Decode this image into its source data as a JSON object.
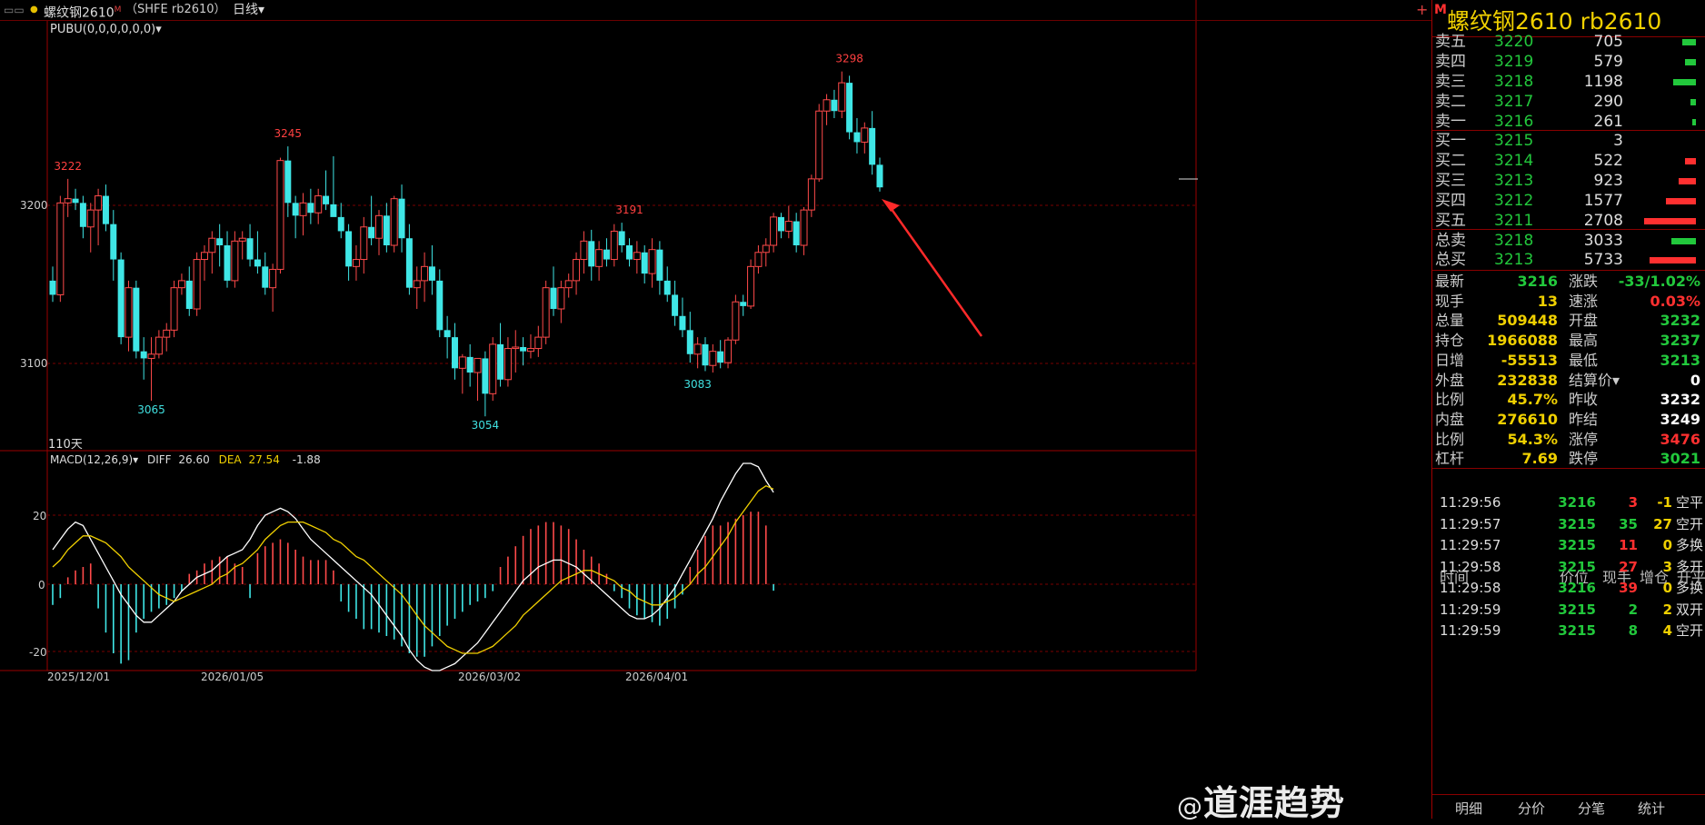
{
  "top_bar": {
    "window_icons": "▭▭",
    "dot": "●",
    "title": "螺纹钢2610",
    "badge": "M",
    "code": "（SHFE rb2610）",
    "period": "日线",
    "period_caret": "▾",
    "add": "+"
  },
  "main_chart": {
    "indicator": "PUBU(0,0,0,0,0,0)",
    "indicator_caret": "▾",
    "days_label": "110天",
    "y_ticks": [
      "3200",
      "3100"
    ],
    "annotations": [
      {
        "text": "3222",
        "color": "#ff4040"
      },
      {
        "text": "3245",
        "color": "#ff4040"
      },
      {
        "text": "3065",
        "color": "#40e0e0"
      },
      {
        "text": "3054",
        "color": "#40e0e0"
      },
      {
        "text": "3191",
        "color": "#ff4040"
      },
      {
        "text": "3083",
        "color": "#40e0e0"
      },
      {
        "text": "3298",
        "color": "#ff4040"
      }
    ]
  },
  "macd": {
    "name": "MACD(12,26,9)",
    "caret": "▾",
    "diff_label": "DIFF",
    "diff_value": "26.60",
    "dea_label": "DEA",
    "dea_value": "27.54",
    "macd_value": "-1.88",
    "y_ticks": [
      "20",
      "0",
      "-20"
    ]
  },
  "x_axis": {
    "dates": [
      "2025/12/01",
      "2026/01/05",
      "2026/03/02",
      "2026/04/01"
    ]
  },
  "right_panel": {
    "marker": "M",
    "title": "螺纹钢2610  rb2610",
    "asks": [
      {
        "label": "卖五",
        "price": "3220",
        "vol": "705",
        "bar": 0.1
      },
      {
        "label": "卖四",
        "price": "3219",
        "vol": "579",
        "bar": 0.08
      },
      {
        "label": "卖三",
        "price": "3218",
        "vol": "1198",
        "bar": 0.17
      },
      {
        "label": "卖二",
        "price": "3217",
        "vol": "290",
        "bar": 0.04
      },
      {
        "label": "卖一",
        "price": "3216",
        "vol": "261",
        "bar": 0.03
      }
    ],
    "bids": [
      {
        "label": "买一",
        "price": "3215",
        "vol": "3",
        "bar": 0
      },
      {
        "label": "买二",
        "price": "3214",
        "vol": "522",
        "bar": 0.08
      },
      {
        "label": "买三",
        "price": "3213",
        "vol": "923",
        "bar": 0.13
      },
      {
        "label": "买四",
        "price": "3212",
        "vol": "1577",
        "bar": 0.22
      },
      {
        "label": "买五",
        "price": "3211",
        "vol": "2708",
        "bar": 0.38
      }
    ],
    "totals": [
      {
        "label": "总卖",
        "price": "3218",
        "vol": "3033",
        "bar": 0.18,
        "color": "#22c83c"
      },
      {
        "label": "总买",
        "price": "3213",
        "vol": "5733",
        "bar": 0.34,
        "color": "#ff3030"
      }
    ],
    "quotes": [
      {
        "l": "最新",
        "v": "3216",
        "vc": "#22c83c",
        "l2": "涨跌",
        "v2": "-33/1.02%",
        "v2c": "#22c83c"
      },
      {
        "l": "现手",
        "v": "13",
        "vc": "#f0d000",
        "l2": "速涨",
        "v2": "0.03%",
        "v2c": "#ff3030"
      },
      {
        "l": "总量",
        "v": "509448",
        "vc": "#f0d000",
        "l2": "开盘",
        "v2": "3232",
        "v2c": "#22c83c"
      },
      {
        "l": "持仓",
        "v": "1966088",
        "vc": "#f0d000",
        "l2": "最高",
        "v2": "3237",
        "v2c": "#22c83c"
      },
      {
        "l": "日增",
        "v": "-55513",
        "vc": "#f0d000",
        "l2": "最低",
        "v2": "3213",
        "v2c": "#22c83c"
      },
      {
        "l": "外盘",
        "v": "232838",
        "vc": "#f0d000",
        "l2": "结算价▾",
        "v2": "0",
        "v2c": "#ffffff"
      },
      {
        "l": "比例",
        "v": "45.7%",
        "vc": "#f0d000",
        "l2": "昨收",
        "v2": "3232",
        "v2c": "#ffffff"
      },
      {
        "l": "内盘",
        "v": "276610",
        "vc": "#f0d000",
        "l2": "昨结",
        "v2": "3249",
        "v2c": "#ffffff"
      },
      {
        "l": "比例",
        "v": "54.3%",
        "vc": "#f0d000",
        "l2": "涨停",
        "v2": "3476",
        "v2c": "#ff3030"
      },
      {
        "l": "杠杆",
        "v": "7.69",
        "vc": "#f0d000",
        "l2": "跌停",
        "v2": "3021",
        "v2c": "#22c83c"
      }
    ],
    "trade_headers": [
      "时间",
      "价位",
      "现手",
      "增仓",
      "开平"
    ],
    "trades": [
      {
        "time": "11:29:56",
        "price": "3216",
        "vol": "3",
        "vc": "#ff3030",
        "chg": "-1",
        "type": "空平"
      },
      {
        "time": "11:29:57",
        "price": "3215",
        "vol": "35",
        "vc": "#22c83c",
        "chg": "27",
        "type": "空开"
      },
      {
        "time": "11:29:57",
        "price": "3215",
        "vol": "11",
        "vc": "#ff3030",
        "chg": "0",
        "type": "多换"
      },
      {
        "time": "11:29:58",
        "price": "3215",
        "vol": "27",
        "vc": "#ff3030",
        "chg": "3",
        "type": "多开"
      },
      {
        "time": "11:29:58",
        "price": "3216",
        "vol": "39",
        "vc": "#ff3030",
        "chg": "0",
        "type": "多换"
      },
      {
        "time": "11:29:59",
        "price": "3215",
        "vol": "2",
        "vc": "#22c83c",
        "chg": "2",
        "type": "双开"
      },
      {
        "time": "11:29:59",
        "price": "3215",
        "vol": "8",
        "vc": "#22c83c",
        "chg": "4",
        "type": "空开"
      }
    ],
    "tabs": [
      "明细",
      "分价",
      "分笔",
      "统计"
    ]
  },
  "watermark": {
    "at": "@",
    "text": "道涯趋势"
  },
  "chart_data": {
    "type": "candlestick",
    "y_min": 3040,
    "y_max": 3310,
    "macd_range": [
      -27,
      35
    ],
    "candles": [
      [
        3150,
        3160,
        3135,
        3140
      ],
      [
        3140,
        3210,
        3135,
        3205
      ],
      [
        3205,
        3222,
        3195,
        3208
      ],
      [
        3208,
        3215,
        3200,
        3205
      ],
      [
        3205,
        3210,
        3180,
        3188
      ],
      [
        3188,
        3205,
        3170,
        3200
      ],
      [
        3200,
        3215,
        3175,
        3210
      ],
      [
        3210,
        3218,
        3185,
        3190
      ],
      [
        3190,
        3200,
        3150,
        3165
      ],
      [
        3165,
        3170,
        3105,
        3110
      ],
      [
        3110,
        3150,
        3100,
        3145
      ],
      [
        3145,
        3150,
        3095,
        3100
      ],
      [
        3100,
        3110,
        3080,
        3095
      ],
      [
        3095,
        3110,
        3065,
        3098
      ],
      [
        3098,
        3115,
        3095,
        3110
      ],
      [
        3110,
        3120,
        3100,
        3115
      ],
      [
        3115,
        3150,
        3110,
        3145
      ],
      [
        3145,
        3155,
        3140,
        3150
      ],
      [
        3150,
        3160,
        3125,
        3130
      ],
      [
        3130,
        3170,
        3125,
        3165
      ],
      [
        3165,
        3175,
        3150,
        3170
      ],
      [
        3170,
        3185,
        3155,
        3180
      ],
      [
        3180,
        3190,
        3160,
        3175
      ],
      [
        3175,
        3185,
        3145,
        3150
      ],
      [
        3150,
        3185,
        3145,
        3178
      ],
      [
        3178,
        3185,
        3165,
        3180
      ],
      [
        3180,
        3190,
        3160,
        3165
      ],
      [
        3165,
        3185,
        3155,
        3160
      ],
      [
        3160,
        3170,
        3140,
        3145
      ],
      [
        3145,
        3162,
        3128,
        3158
      ],
      [
        3158,
        3237,
        3155,
        3235
      ],
      [
        3235,
        3245,
        3195,
        3205
      ],
      [
        3205,
        3210,
        3180,
        3196
      ],
      [
        3196,
        3212,
        3182,
        3205
      ],
      [
        3205,
        3215,
        3190,
        3198
      ],
      [
        3198,
        3215,
        3190,
        3210
      ],
      [
        3210,
        3228,
        3200,
        3204
      ],
      [
        3204,
        3238,
        3200,
        3195
      ],
      [
        3195,
        3205,
        3180,
        3185
      ],
      [
        3185,
        3190,
        3150,
        3160
      ],
      [
        3160,
        3175,
        3150,
        3165
      ],
      [
        3165,
        3195,
        3155,
        3188
      ],
      [
        3188,
        3210,
        3175,
        3180
      ],
      [
        3180,
        3200,
        3168,
        3196
      ],
      [
        3196,
        3205,
        3170,
        3175
      ],
      [
        3175,
        3210,
        3170,
        3208
      ],
      [
        3208,
        3218,
        3170,
        3180
      ],
      [
        3180,
        3190,
        3140,
        3145
      ],
      [
        3145,
        3160,
        3130,
        3150
      ],
      [
        3150,
        3170,
        3135,
        3160
      ],
      [
        3160,
        3175,
        3140,
        3150
      ],
      [
        3150,
        3158,
        3110,
        3115
      ],
      [
        3115,
        3125,
        3095,
        3110
      ],
      [
        3110,
        3120,
        3080,
        3088
      ],
      [
        3088,
        3098,
        3070,
        3096
      ],
      [
        3096,
        3105,
        3075,
        3085
      ],
      [
        3085,
        3095,
        3065,
        3095
      ],
      [
        3095,
        3100,
        3054,
        3070
      ],
      [
        3070,
        3110,
        3065,
        3105
      ],
      [
        3105,
        3120,
        3075,
        3080
      ],
      [
        3080,
        3110,
        3075,
        3102
      ],
      [
        3102,
        3115,
        3085,
        3103
      ],
      [
        3103,
        3110,
        3090,
        3100
      ],
      [
        3100,
        3112,
        3095,
        3102
      ],
      [
        3102,
        3118,
        3096,
        3110
      ],
      [
        3110,
        3150,
        3105,
        3145
      ],
      [
        3145,
        3160,
        3125,
        3130
      ],
      [
        3130,
        3150,
        3120,
        3145
      ],
      [
        3145,
        3155,
        3138,
        3150
      ],
      [
        3150,
        3170,
        3140,
        3165
      ],
      [
        3165,
        3185,
        3155,
        3178
      ],
      [
        3178,
        3186,
        3150,
        3160
      ],
      [
        3160,
        3178,
        3150,
        3172
      ],
      [
        3172,
        3180,
        3160,
        3165
      ],
      [
        3165,
        3190,
        3160,
        3185
      ],
      [
        3185,
        3191,
        3170,
        3175
      ],
      [
        3175,
        3180,
        3160,
        3165
      ],
      [
        3165,
        3178,
        3155,
        3170
      ],
      [
        3170,
        3175,
        3148,
        3155
      ],
      [
        3155,
        3180,
        3145,
        3172
      ],
      [
        3172,
        3178,
        3140,
        3150
      ],
      [
        3150,
        3160,
        3135,
        3140
      ],
      [
        3140,
        3150,
        3118,
        3125
      ],
      [
        3125,
        3138,
        3110,
        3115
      ],
      [
        3115,
        3128,
        3092,
        3098
      ],
      [
        3098,
        3110,
        3088,
        3105
      ],
      [
        3105,
        3110,
        3086,
        3090
      ],
      [
        3090,
        3105,
        3085,
        3100
      ],
      [
        3100,
        3108,
        3088,
        3092
      ],
      [
        3092,
        3110,
        3088,
        3108
      ],
      [
        3108,
        3140,
        3105,
        3135
      ],
      [
        3135,
        3140,
        3125,
        3132
      ],
      [
        3132,
        3165,
        3130,
        3160
      ],
      [
        3160,
        3175,
        3155,
        3170
      ],
      [
        3170,
        3180,
        3160,
        3175
      ],
      [
        3175,
        3198,
        3170,
        3195
      ],
      [
        3195,
        3198,
        3180,
        3185
      ],
      [
        3185,
        3203,
        3180,
        3192
      ],
      [
        3192,
        3198,
        3170,
        3175
      ],
      [
        3175,
        3202,
        3168,
        3200
      ],
      [
        3200,
        3225,
        3195,
        3222
      ],
      [
        3222,
        3275,
        3220,
        3270
      ],
      [
        3270,
        3282,
        3260,
        3278
      ],
      [
        3278,
        3285,
        3265,
        3270
      ],
      [
        3270,
        3298,
        3265,
        3290
      ],
      [
        3290,
        3295,
        3250,
        3255
      ],
      [
        3255,
        3265,
        3240,
        3248
      ],
      [
        3248,
        3262,
        3240,
        3258
      ],
      [
        3258,
        3270,
        3225,
        3232
      ],
      [
        3232,
        3237,
        3213,
        3216
      ]
    ],
    "macd": {
      "dif": [
        10,
        13,
        16,
        18,
        17,
        13,
        9,
        5,
        1,
        -3,
        -6,
        -9,
        -11,
        -11,
        -9,
        -7,
        -5,
        -2,
        0,
        2,
        3,
        4,
        6,
        8,
        9,
        10,
        13,
        17,
        20,
        21,
        22,
        21,
        19,
        16,
        13,
        11,
        9,
        7,
        5,
        3,
        1,
        -1,
        -3,
        -6,
        -9,
        -12,
        -15,
        -19,
        -22,
        -24,
        -25,
        -25,
        -24,
        -23,
        -21,
        -19,
        -17,
        -14,
        -11,
        -8,
        -5,
        -2,
        1,
        3,
        5,
        6,
        7,
        7,
        6,
        5,
        3,
        1,
        -1,
        -3,
        -5,
        -7,
        -9,
        -10,
        -10,
        -9,
        -7,
        -4,
        -1,
        3,
        7,
        11,
        15,
        19,
        24,
        28,
        32,
        35,
        35,
        34,
        30,
        26.6
      ],
      "dea": [
        5,
        7,
        10,
        12,
        14,
        14,
        13,
        12,
        10,
        8,
        5,
        3,
        1,
        -1,
        -3,
        -4,
        -5,
        -4,
        -3,
        -2,
        -1,
        0,
        2,
        3,
        5,
        6,
        8,
        10,
        13,
        15,
        17,
        18,
        18,
        18,
        17,
        16,
        15,
        13,
        12,
        10,
        8,
        7,
        5,
        3,
        1,
        -1,
        -3,
        -6,
        -9,
        -12,
        -14,
        -16,
        -18,
        -19,
        -20,
        -20,
        -20,
        -19,
        -18,
        -16,
        -14,
        -12,
        -9,
        -7,
        -5,
        -3,
        -1,
        1,
        2,
        3,
        4,
        4,
        3,
        2,
        1,
        -1,
        -2,
        -4,
        -5,
        -6,
        -6,
        -5,
        -4,
        -2,
        0,
        3,
        5,
        8,
        11,
        14,
        18,
        21,
        24,
        27,
        28.5,
        27.54
      ],
      "hist": [
        -6,
        -4,
        2,
        4,
        5,
        6,
        -7,
        -14,
        -20,
        -23,
        -22,
        -14,
        -10,
        -8,
        -7,
        -6,
        -4,
        -2,
        3,
        4,
        6,
        7,
        8,
        8,
        6,
        5,
        -4,
        9,
        11,
        12,
        13,
        12,
        10,
        8,
        7,
        7,
        7,
        4,
        -5,
        -8,
        -10,
        -13,
        -13,
        -14,
        -15,
        -16,
        -18,
        -20,
        -21,
        -21,
        -18,
        -15,
        -12,
        -10,
        -8,
        -6,
        -5,
        -4,
        -2,
        5,
        8,
        11,
        14,
        16,
        17,
        18,
        18,
        17,
        16,
        13,
        10,
        8,
        6,
        3,
        -2,
        -4,
        -7,
        -9,
        -10,
        -11,
        -12,
        -10,
        -7,
        -3,
        5,
        10,
        14,
        17,
        17,
        18,
        19,
        20,
        21,
        21,
        17,
        -1.88
      ]
    }
  }
}
